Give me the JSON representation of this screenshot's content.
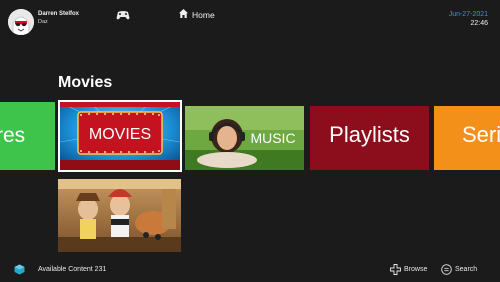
{
  "user": {
    "name": "Darren Stelfox",
    "tag": "Daz",
    "avatar_icon": "stormtrooper-avatar"
  },
  "header": {
    "controller_icon": "controller-icon",
    "home_icon": "home-icon",
    "home_label": "Home",
    "date": "Jun-27-2021",
    "time": "22:46"
  },
  "section": {
    "title": "Movies"
  },
  "tiles": [
    {
      "label": "res",
      "color": "#3ec44a"
    },
    {
      "label": "MOVIES",
      "color": "#1a8fd6",
      "selected": true
    },
    {
      "label": "MUSIC",
      "color": "#4d8a2c"
    },
    {
      "label": "Playlists",
      "color": "#8c0e1c"
    },
    {
      "label": "Seri",
      "color": "#f39019"
    },
    {
      "label": "",
      "image": "toy-story-poster"
    }
  ],
  "footer": {
    "content_label": "Available Content 231",
    "browse_label": "Browse",
    "search_label": "Search"
  },
  "colors": {
    "accent": "#3f8ee8",
    "background": "#1b1b1b"
  }
}
